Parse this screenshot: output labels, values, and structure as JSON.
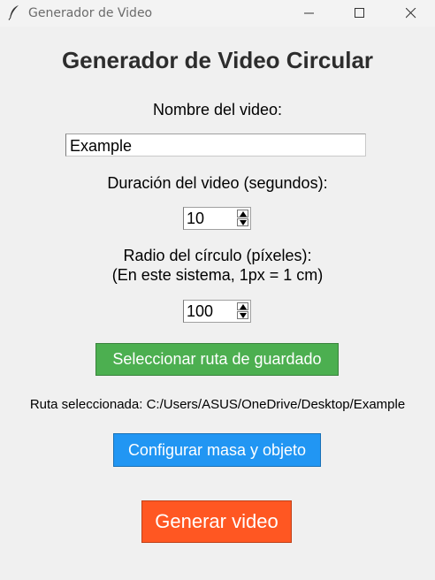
{
  "window": {
    "title": "Generador de Video",
    "icon": "feather-icon"
  },
  "main": {
    "heading": "Generador de Video Circular",
    "name_label": "Nombre del video:",
    "name_value": "Example",
    "duration_label": "Duración del video (segundos):",
    "duration_value": "10",
    "radius_label_line1": "Radio del círculo (píxeles):",
    "radius_label_line2": "(En este sistema, 1px = 1 cm)",
    "radius_value": "100",
    "select_path_button": "Seleccionar ruta de guardado",
    "selected_path_text": "Ruta seleccionada: C:/Users/ASUS/OneDrive/Desktop/Example",
    "configure_button": "Configurar masa y objeto",
    "generate_button": "Generar video"
  },
  "colors": {
    "select_path_button": "#4caf50",
    "configure_button": "#2196f3",
    "generate_button": "#ff5722",
    "background": "#f0f0f0"
  }
}
